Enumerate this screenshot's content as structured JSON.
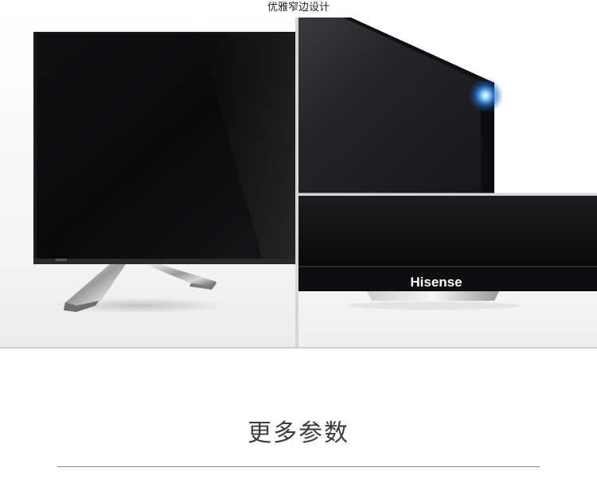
{
  "caption": {
    "text": "优雅窄边设计"
  },
  "panels": {
    "left": {
      "subject": "tv-front-corner-with-stand"
    },
    "top_right": {
      "subject": "tv-side-bezel-with-blue-glint"
    },
    "bottom_right": {
      "subject": "tv-bottom-bezel-logo",
      "logo_text": "Hisense"
    }
  },
  "section": {
    "heading": "更多参数"
  },
  "colors": {
    "screen": "#0b0b0c",
    "bezel": "#1c1c1e",
    "background": "#ffffff",
    "rule": "#8a8a8a",
    "glint": "#3fa0ff"
  }
}
